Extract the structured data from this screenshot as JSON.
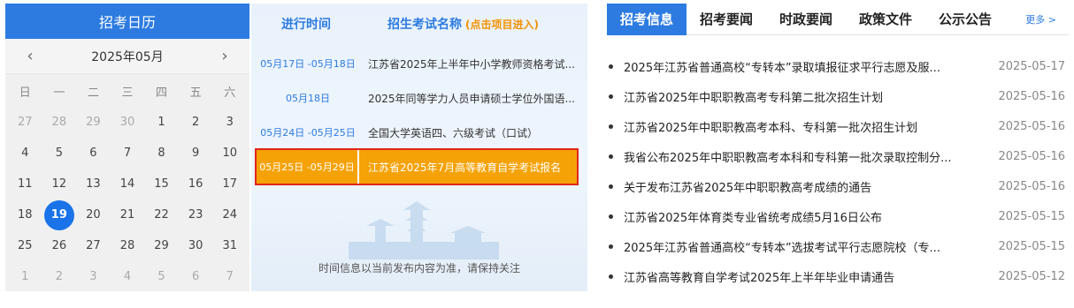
{
  "calendar": {
    "title": "招考日历",
    "prev": "‹",
    "next": "›",
    "month": "2025年05月",
    "weekdays": [
      "日",
      "一",
      "二",
      "三",
      "四",
      "五",
      "六"
    ],
    "days": [
      {
        "n": "27",
        "muted": true
      },
      {
        "n": "28",
        "muted": true
      },
      {
        "n": "29",
        "muted": true
      },
      {
        "n": "30",
        "muted": true
      },
      {
        "n": "1"
      },
      {
        "n": "2"
      },
      {
        "n": "3"
      },
      {
        "n": "4"
      },
      {
        "n": "5"
      },
      {
        "n": "6"
      },
      {
        "n": "7"
      },
      {
        "n": "8"
      },
      {
        "n": "9"
      },
      {
        "n": "10"
      },
      {
        "n": "11"
      },
      {
        "n": "12"
      },
      {
        "n": "13"
      },
      {
        "n": "14"
      },
      {
        "n": "15"
      },
      {
        "n": "16"
      },
      {
        "n": "17"
      },
      {
        "n": "18"
      },
      {
        "n": "19",
        "today": true
      },
      {
        "n": "20"
      },
      {
        "n": "21"
      },
      {
        "n": "22"
      },
      {
        "n": "23"
      },
      {
        "n": "24"
      },
      {
        "n": "25"
      },
      {
        "n": "26"
      },
      {
        "n": "27"
      },
      {
        "n": "28"
      },
      {
        "n": "29"
      },
      {
        "n": "30"
      },
      {
        "n": "31"
      },
      {
        "n": "1",
        "muted": true
      },
      {
        "n": "2",
        "muted": true
      },
      {
        "n": "3",
        "muted": true
      },
      {
        "n": "4",
        "muted": true
      },
      {
        "n": "5",
        "muted": true
      },
      {
        "n": "6",
        "muted": true
      },
      {
        "n": "7",
        "muted": true
      }
    ]
  },
  "schedule": {
    "col_time": "进行时间",
    "col_name": "招生考试名称",
    "col_hint": "(点击项目进入)",
    "rows": [
      {
        "date": "05月17日 -05月18日",
        "name": "江苏省2025年上半年中小学教师资格考试...",
        "active": false
      },
      {
        "date": "05月18日",
        "name": "2025年同等学力人员申请硕士学位外国语...",
        "active": false
      },
      {
        "date": "05月24日 -05月25日",
        "name": "全国大学英语四、六级考试（口试）",
        "active": false
      },
      {
        "date": "05月25日 -05月29日",
        "name": "江苏省2025年7月高等教育自学考试报名",
        "active": true
      }
    ],
    "footer": "时间信息以当前发布内容为准，请保持关注"
  },
  "news": {
    "tabs": [
      "招考信息",
      "招考要闻",
      "时政要闻",
      "政策文件",
      "公示公告"
    ],
    "active_tab": 0,
    "more": "更多 >",
    "items": [
      {
        "title": "2025年江苏省普通高校“专转本”录取填报征求平行志愿及服...",
        "date": "2025-05-17"
      },
      {
        "title": "江苏省2025年中职职教高考专科第二批次招生计划",
        "date": "2025-05-16"
      },
      {
        "title": "江苏省2025年中职职教高考本科、专科第一批次招生计划",
        "date": "2025-05-16"
      },
      {
        "title": "我省公布2025年中职职教高考本科和专科第一批次录取控制分...",
        "date": "2025-05-16"
      },
      {
        "title": "关于发布江苏省2025年中职职教高考成绩的通告",
        "date": "2025-05-16"
      },
      {
        "title": "江苏省2025年体育类专业省统考成绩5月16日公布",
        "date": "2025-05-15"
      },
      {
        "title": "2025年江苏省普通高校“专转本”选拔考试平行志愿院校（专...",
        "date": "2025-05-15"
      },
      {
        "title": "江苏省高等教育自学考试2025年上半年毕业申请通告",
        "date": "2025-05-12"
      }
    ]
  },
  "colors": {
    "primary": "#2d7be0",
    "today": "#1a73e8",
    "active_row": "#f5a206",
    "active_border": "#e0261b",
    "hint": "#f39200"
  }
}
